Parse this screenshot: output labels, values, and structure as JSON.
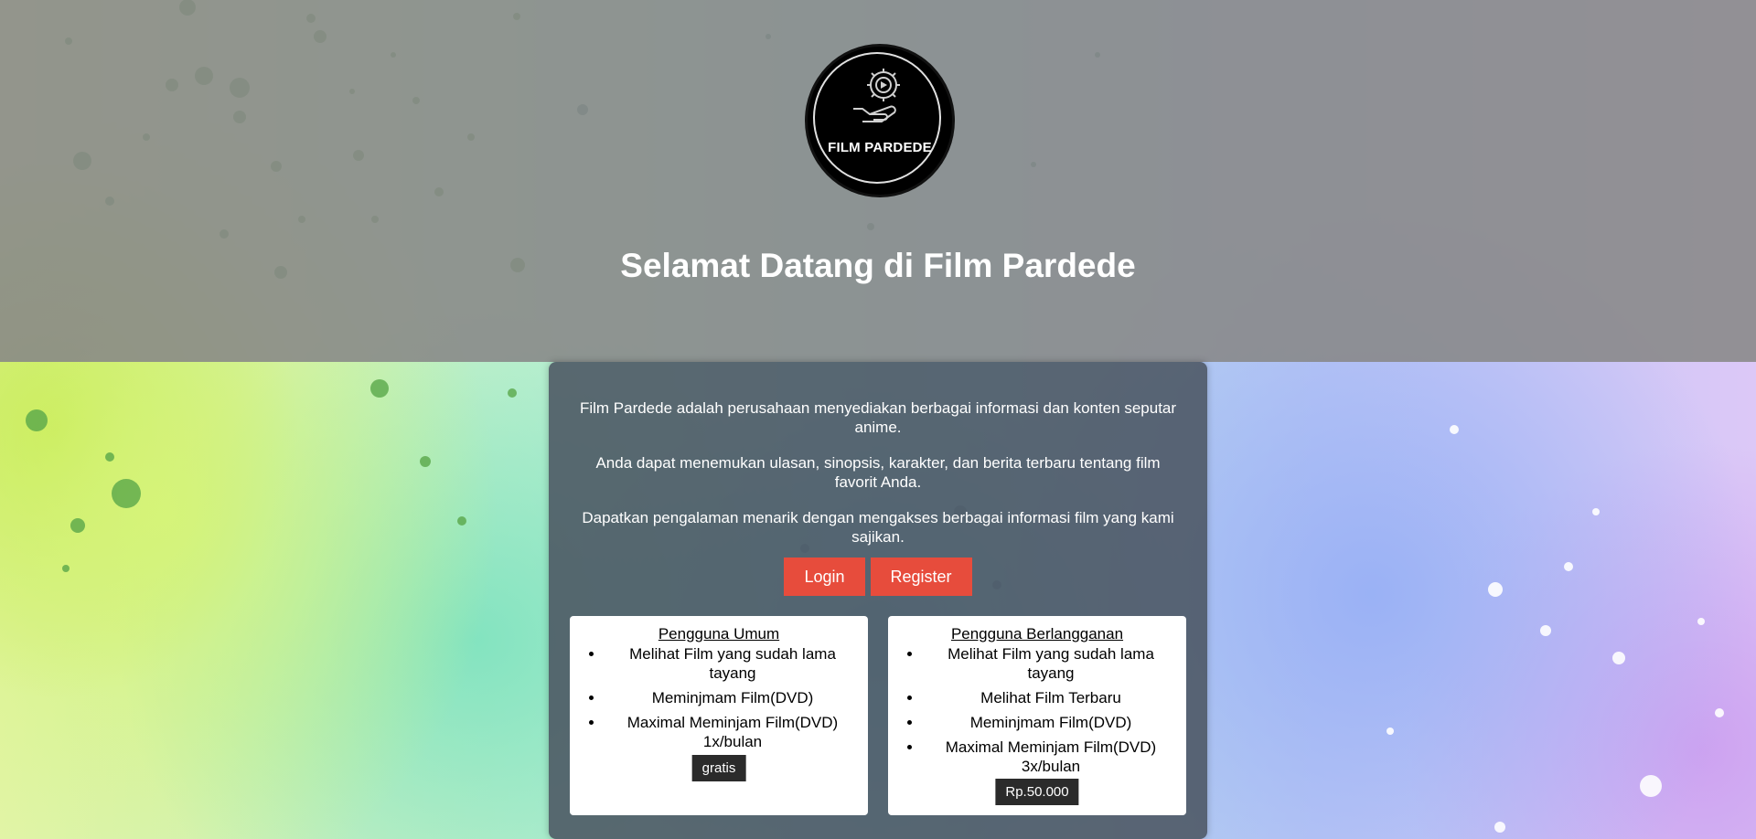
{
  "header": {
    "logo_text": "FILM PARDEDE",
    "title": "Selamat Datang di Film Pardede"
  },
  "intro": {
    "paragraphs": [
      "Film Pardede adalah perusahaan menyediakan berbagai informasi dan konten seputar anime.",
      "Anda dapat menemukan ulasan, sinopsis, karakter, dan berita terbaru tentang film favorit Anda.",
      "Dapatkan pengalaman menarik dengan mengakses berbagai informasi film yang kami sajikan."
    ]
  },
  "actions": {
    "login_label": "Login",
    "register_label": "Register"
  },
  "plans": [
    {
      "title": "Pengguna Umum",
      "features": [
        "Melihat Film yang sudah lama tayang",
        "Meminjmam Film(DVD)",
        "Maximal Meminjam Film(DVD) 1x/bulan"
      ],
      "price": "gratis"
    },
    {
      "title": "Pengguna Berlangganan",
      "features": [
        "Melihat Film yang sudah lama tayang",
        "Melihat Film Terbaru",
        "Meminjmam Film(DVD)",
        "Maximal Meminjam Film(DVD) 3x/bulan"
      ],
      "price": "Rp.50.000"
    }
  ],
  "colors": {
    "button": "#e74c3c",
    "hero_overlay": "#878787",
    "card_overlay": "#4b5562",
    "price_badge": "#2b2b2b"
  },
  "icons": {
    "logo": "gear-play-hand-icon"
  }
}
